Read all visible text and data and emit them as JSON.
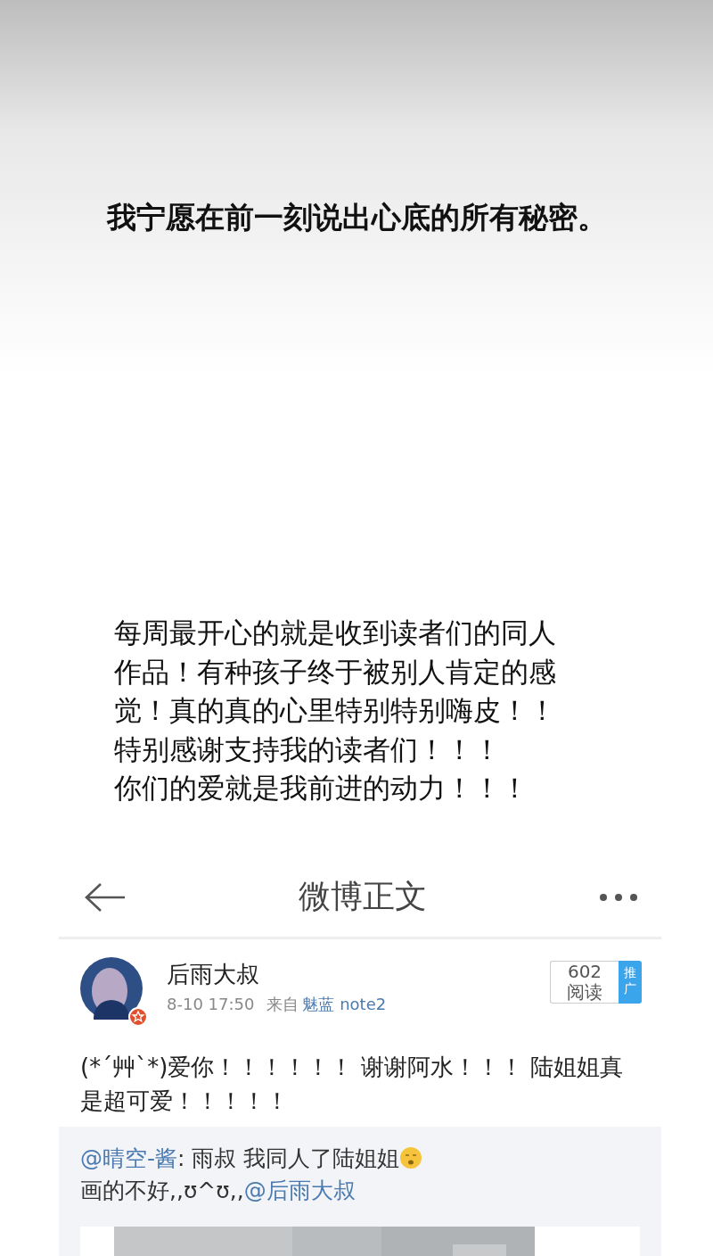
{
  "caption": "我宁愿在前一刻说出心底的所有秘密。",
  "message": [
    "每周最开心的就是收到读者们的同人",
    "作品！有种孩子终于被别人肯定的感",
    "觉！真的真的心里特别特别嗨皮！！",
    "特别感谢支持我的读者们！！！",
    "你们的爱就是我前进的动力！！！"
  ],
  "weibo": {
    "title": "微博正文",
    "post": {
      "author": "后雨大叔",
      "time": "8-10 17:50",
      "source_label": "来自",
      "source": "魅蓝 note2",
      "reads": "602",
      "reads_label": "阅读",
      "promote": "推广",
      "text": "(*´艸`*)爱你！！！！！！ 谢谢阿水！！！ 陆姐姐真是超可爱！！！！！",
      "repost": [
        {
          "kind": "mention",
          "text": "@晴空-酱"
        },
        {
          "kind": "text",
          "text": ": 雨叔 我同人了陆姐姐"
        },
        {
          "kind": "emoji"
        },
        {
          "kind": "text",
          "text": "画的不好,,ʊ^ʊ,,"
        },
        {
          "kind": "mention",
          "text": "@后雨大叔"
        }
      ]
    }
  }
}
